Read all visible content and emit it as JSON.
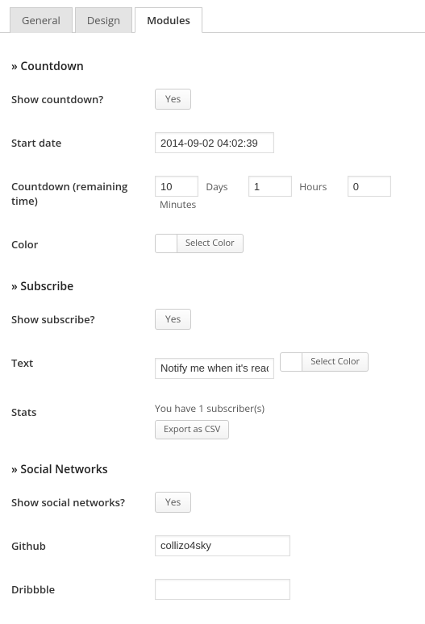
{
  "tabs": {
    "general": "General",
    "design": "Design",
    "modules": "Modules"
  },
  "sections": {
    "countdown": {
      "title": "» Countdown"
    },
    "subscribe": {
      "title": "» Subscribe"
    },
    "social": {
      "title": "» Social Networks"
    }
  },
  "countdown": {
    "show_label": "Show countdown?",
    "show_value": "Yes",
    "startdate_label": "Start date",
    "startdate_value": "2014-09-02 04:02:39",
    "remaining_label": "Countdown (remaining time)",
    "days_value": "10",
    "days_label": "Days",
    "hours_value": "1",
    "hours_label": "Hours",
    "minutes_value": "0",
    "minutes_label": "Minutes",
    "color_label": "Color",
    "select_color": "Select Color"
  },
  "subscribe": {
    "show_label": "Show subscribe?",
    "show_value": "Yes",
    "text_label": "Text",
    "text_value": "Notify me when it's ready",
    "select_color": "Select Color",
    "stats_label": "Stats",
    "stats_text": "You have 1 subscriber(s)",
    "export_label": "Export as CSV"
  },
  "social": {
    "show_label": "Show social networks?",
    "show_value": "Yes",
    "github_label": "Github",
    "github_value": "collizo4sky",
    "dribbble_label": "Dribbble",
    "dribbble_value": ""
  }
}
